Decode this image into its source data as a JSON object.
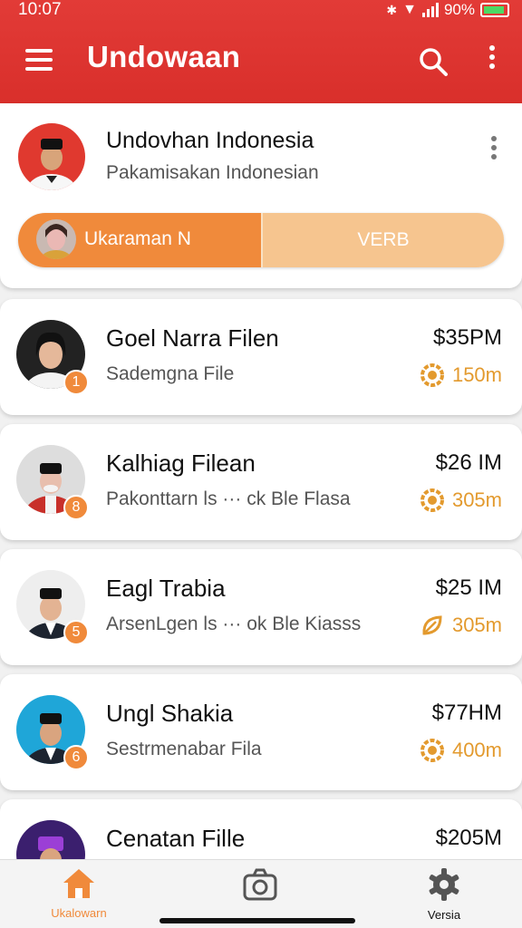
{
  "status_bar": {
    "time": "10:07",
    "battery": "90%"
  },
  "app_bar": {
    "title": "Undowaan",
    "menu_icon": "hamburger-menu-icon",
    "search_icon": "search-icon",
    "more_icon": "more-vertical-icon"
  },
  "header_card": {
    "title": "Undovhan Indonesia",
    "subtitle": "Pakamisakan Indonesian",
    "segment_left": "Ukaraman N",
    "segment_right": "VERB"
  },
  "items": [
    {
      "name": "Goel Narra Filen",
      "subtitle": "Sademgna File",
      "price": "$35PM",
      "distance": "150m",
      "rank": "1"
    },
    {
      "name": "Kalhiag Filean",
      "subtitle": "Pakonttarn ls ··· ck Ble Flasa",
      "price": "$26 IM",
      "distance": "305m",
      "rank": "8"
    },
    {
      "name": "Eagl Trabia",
      "subtitle": "ArsenLgen ls ··· ok Ble Kiasss",
      "price": "$25 IM",
      "distance": "305m",
      "rank": "5"
    },
    {
      "name": "Ungl Shakia",
      "subtitle": "Sestrmenabar Fila",
      "price": "$77HM",
      "distance": "400m",
      "rank": "6"
    },
    {
      "name": "Cenatan Fille",
      "subtitle": "",
      "price": "$205M",
      "distance": "",
      "rank": ""
    }
  ],
  "bottom_nav": [
    {
      "label": "Ukalowarn",
      "icon": "home-icon",
      "active": true
    },
    {
      "label": "",
      "icon": "camera-icon",
      "active": false
    },
    {
      "label": "Versia",
      "icon": "gear-icon",
      "active": false
    }
  ],
  "colors": {
    "primary": "#d92f2b",
    "accent": "#f08a3b",
    "accent_light": "#f6c58f",
    "distance": "#e39a2e"
  }
}
